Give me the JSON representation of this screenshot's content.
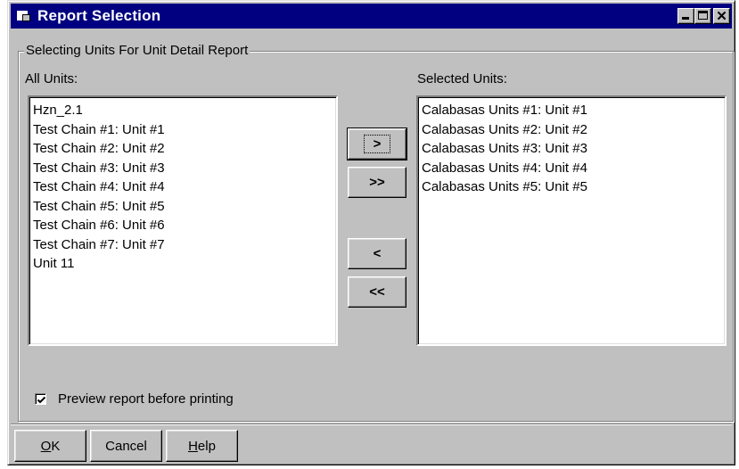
{
  "window": {
    "title": "Report Selection"
  },
  "group": {
    "title": "Selecting Units For Unit Detail Report"
  },
  "all_units": {
    "label": "All Units:",
    "items": [
      "Hzn_2.1",
      "Test Chain #1: Unit #1",
      "Test Chain #2: Unit #2",
      "Test Chain #3: Unit #3",
      "Test Chain #4: Unit #4",
      "Test Chain #5: Unit #5",
      "Test Chain #6: Unit #6",
      "Test Chain #7: Unit #7",
      "Unit 11"
    ]
  },
  "selected_units": {
    "label": "Selected Units:",
    "items": [
      "Calabasas Units #1: Unit #1",
      "Calabasas Units #2: Unit #2",
      "Calabasas Units #3: Unit #3",
      "Calabasas Units #4: Unit #4",
      "Calabasas Units #5: Unit #5"
    ]
  },
  "transfer_buttons": {
    "add_one": ">",
    "add_all": ">>",
    "remove_one": "<",
    "remove_all": "<<"
  },
  "preview": {
    "label": "Preview report before printing",
    "checked": true
  },
  "footer": {
    "ok_mnemonic": "O",
    "ok_rest": "K",
    "cancel": "Cancel",
    "help_mnemonic": "H",
    "help_rest": "elp"
  },
  "icons": {
    "app": "report-window-icon",
    "minimize": "minimize-icon",
    "maximize": "maximize-icon",
    "close": "close-icon",
    "check": "checkmark-icon"
  }
}
